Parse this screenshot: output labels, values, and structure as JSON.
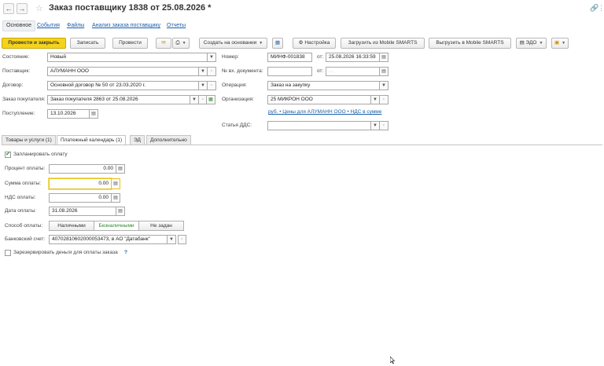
{
  "window": {
    "title": "Заказ поставщику 1838 от 25.08.2026 *"
  },
  "sections": [
    "Основное",
    "События",
    "Файлы",
    "Анализ заказа поставщику",
    "Отчеты"
  ],
  "toolbar": {
    "post_close": "Провести и закрыть",
    "save": "Записать",
    "post": "Провести",
    "create_based": "Создать на основании",
    "settings": "Настройка",
    "load_mobile": "Загрузить из Mobile SMARTS",
    "unload_mobile": "Выгрузить в Mobile SMARTS",
    "edo": "ЭДО"
  },
  "form": {
    "state_label": "Состояние:",
    "state_value": "Новый",
    "supplier_label": "Поставщик:",
    "supplier_value": "АЛУМАНН ООО",
    "contract_label": "Договор:",
    "contract_value": "Основной договор № 50 от 23.03.2020 г.",
    "customer_order_label": "Заказ покупателя:",
    "customer_order_value": "Заказ покупателя 2863 от 25.08.2026",
    "receipt_label": "Поступление:",
    "receipt_value": "13.10.2026",
    "number_label": "Номер:",
    "number_value": "МИНФ-001838",
    "from_label": "от:",
    "from_value": "25.08.2026 16:33:59",
    "incoming_label": "№ вх. документа:",
    "incoming_value": "",
    "incoming_from_label": "от:",
    "incoming_from_value": " .  .",
    "operation_label": "Операция:",
    "operation_value": "Заказ на закупку",
    "org_label": "Организация:",
    "org_value": "25 МИКРОН ООО",
    "price_link": "руб. • Цены для АЛУМАНН ООО • НДС в сумме",
    "dds_label": "Статья ДДС:",
    "dds_value": ""
  },
  "tabs": [
    "Товары и услуги (1)",
    "Платежный календарь (1)",
    "ЭД",
    "Дополнительно"
  ],
  "payment": {
    "plan_label": "Запланировать оплату",
    "plan_checked": true,
    "percent_label": "Процент оплаты:",
    "percent_value": "0.00",
    "sum_label": "Сумма оплаты:",
    "sum_value": "0.00",
    "vat_label": "НДС оплаты:",
    "vat_value": "0.00",
    "date_label": "Дата оплаты:",
    "date_value": "31.08.2026",
    "method_label": "Способ оплаты:",
    "methods": [
      "Наличными",
      "Безналичными",
      "Не задан"
    ],
    "method_selected": "Безналичными",
    "account_label": "Банковский счет:",
    "account_value": "40702810602000053473, в АО \"Датабанк\"",
    "reserve_label": "Зарезервировать деньги для оплаты заказа",
    "reserve_checked": false,
    "help": "?"
  }
}
